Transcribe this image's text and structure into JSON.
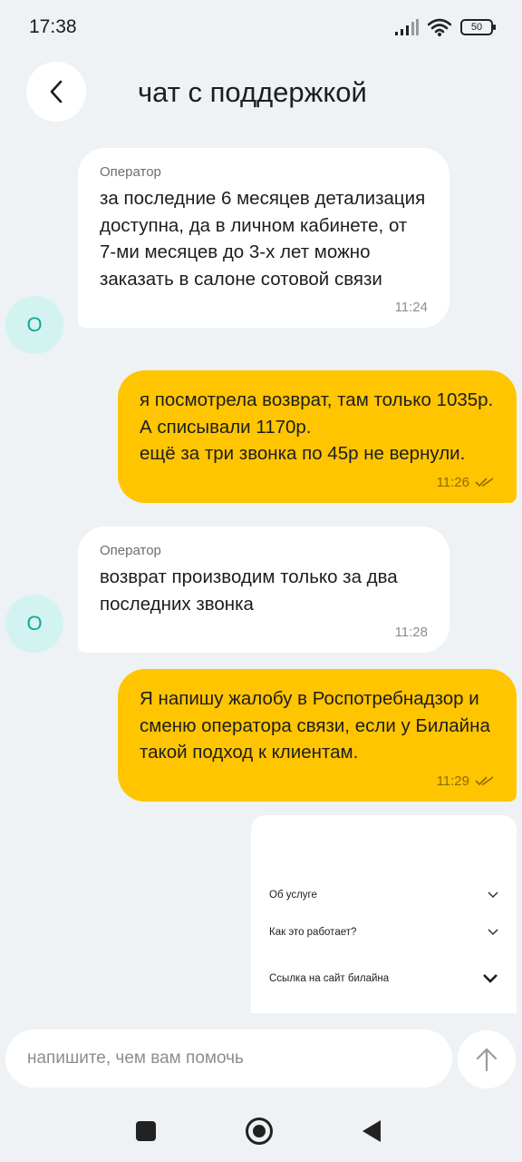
{
  "status": {
    "time": "17:38",
    "battery": "50"
  },
  "header": {
    "title": "чат с поддержкой"
  },
  "messages": [
    {
      "direction": "incoming",
      "sender": "Оператор",
      "text": "за последние 6 месяцев детализация доступна, да в личном кабинете, от 7-ми месяцев до 3-х лет можно заказать в салоне сотовой связи",
      "time": "11:24",
      "avatar": "О"
    },
    {
      "direction": "outgoing",
      "text": "я посмотрела возврат, там только 1035р. А списывали 1170р.\nещё за три звонка по 45р не вернули.",
      "time": "11:26"
    },
    {
      "direction": "incoming",
      "sender": "Оператор",
      "text": "возврат производим только за два последних звонка",
      "time": "11:28",
      "avatar": "О"
    },
    {
      "direction": "outgoing",
      "text": "Я напишу жалобу в Роспотребнадзор и сменю оператора связи, если у Билайна такой подход к клиентам.",
      "time": "11:29"
    }
  ],
  "card": {
    "items": [
      {
        "label": "Об услуге"
      },
      {
        "label": "Как это работает?"
      },
      {
        "label": "Ссылка на сайт билайна"
      }
    ]
  },
  "composer": {
    "placeholder": "напишите, чем вам помочь"
  },
  "icons": {
    "back": "chevron-left-icon",
    "send": "arrow-up-icon",
    "read_receipt": "double-check-icon"
  },
  "colors": {
    "background": "#eef2f5",
    "outgoing_bubble": "#ffc500",
    "incoming_bubble": "#ffffff",
    "avatar_bg": "#d3f3f0",
    "avatar_text": "#11a89a"
  }
}
